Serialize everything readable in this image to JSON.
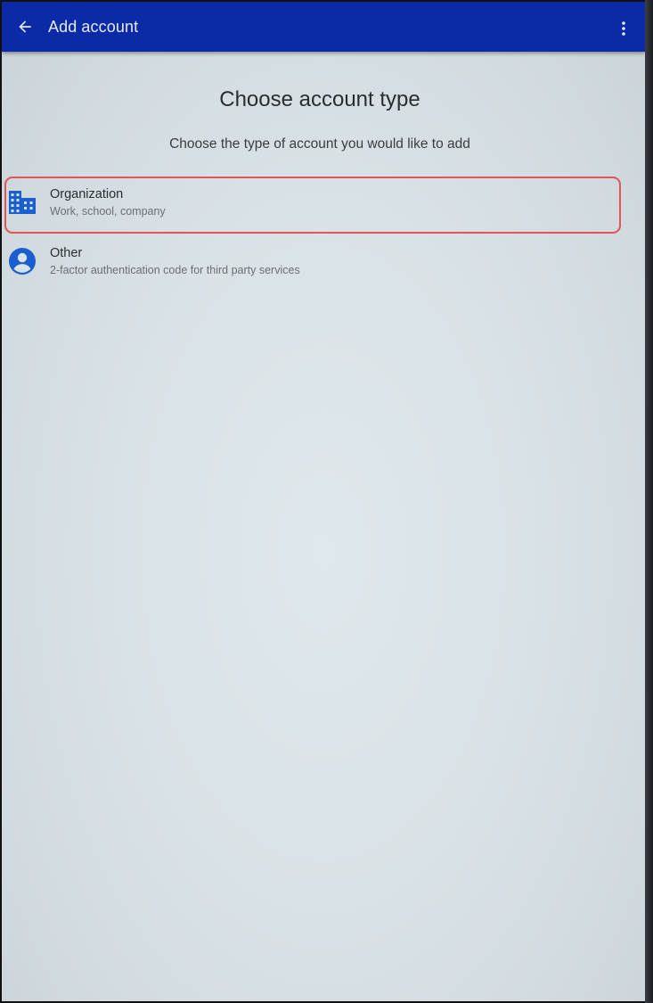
{
  "appbar": {
    "title": "Add account",
    "back_icon": "arrow-left-icon",
    "menu_icon": "more-vert-icon",
    "color": "#0a2aa8"
  },
  "main": {
    "heading": "Choose account type",
    "subheading": "Choose the type of account you would like to add"
  },
  "accounts": [
    {
      "title": "Organization",
      "subtitle": "Work, school, company",
      "icon": "building-icon",
      "highlighted": true
    },
    {
      "title": "Other",
      "subtitle": "2-factor authentication code for third party services",
      "icon": "account-circle-icon",
      "highlighted": false
    }
  ],
  "colors": {
    "accent_blue": "#1a5fd0",
    "highlight_border": "#e05555"
  }
}
